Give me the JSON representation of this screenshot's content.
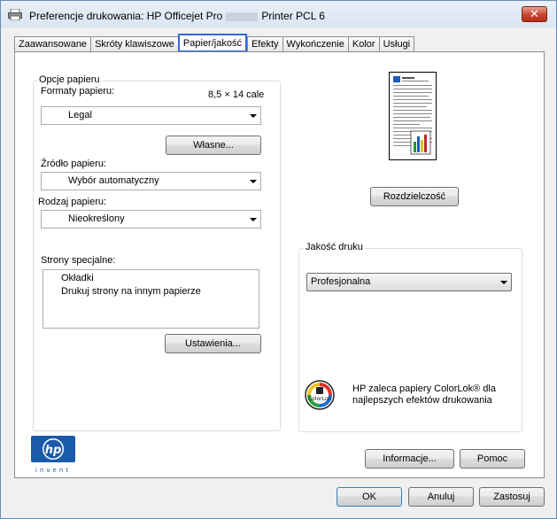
{
  "window": {
    "title_prefix": "Preferencje drukowania: HP Officejet Pro",
    "title_suffix": "Printer PCL 6"
  },
  "tabs": [
    {
      "label": "Zaawansowane"
    },
    {
      "label": "Skróty klawiszowe"
    },
    {
      "label": "Papier/jakość"
    },
    {
      "label": "Efekty"
    },
    {
      "label": "Wykończenie"
    },
    {
      "label": "Kolor"
    },
    {
      "label": "Usługi"
    }
  ],
  "paper_options": {
    "group_title": "Opcje papieru",
    "formats_label": "Formaty papieru:",
    "size_text": "8,5 × 14 cale",
    "format_value": "Legal",
    "custom_button": "Własne...",
    "source_label": "Źródło papieru:",
    "source_value": "Wybór automatyczny",
    "type_label": "Rodzaj papieru:",
    "type_value": "Nieokreślony",
    "special_pages_label": "Strony specjalne:",
    "special_pages_items": [
      "Okładki",
      "Drukuj strony na innym papierze"
    ],
    "settings_button": "Ustawienia..."
  },
  "preview": {
    "resolution_button": "Rozdzielczość"
  },
  "print_quality": {
    "group_title": "Jakość druku",
    "value": "Profesjonalna"
  },
  "colorlok": {
    "line1": "HP zaleca papiery ColorLok® dla",
    "line2": "najlepszych efektów drukowania",
    "badge_text": "ColorLok"
  },
  "hp_logo": {
    "mark": "hp",
    "tagline": "invent"
  },
  "panel_buttons": {
    "info": "Informacje...",
    "help": "Pomoc"
  },
  "dialog_buttons": {
    "ok": "OK",
    "cancel": "Anuluj",
    "apply": "Zastosuj"
  },
  "colors": {
    "active_tab_border": "#2f6ad6",
    "close_button": "#c8452d",
    "hp_blue": "#1a5aa8"
  }
}
